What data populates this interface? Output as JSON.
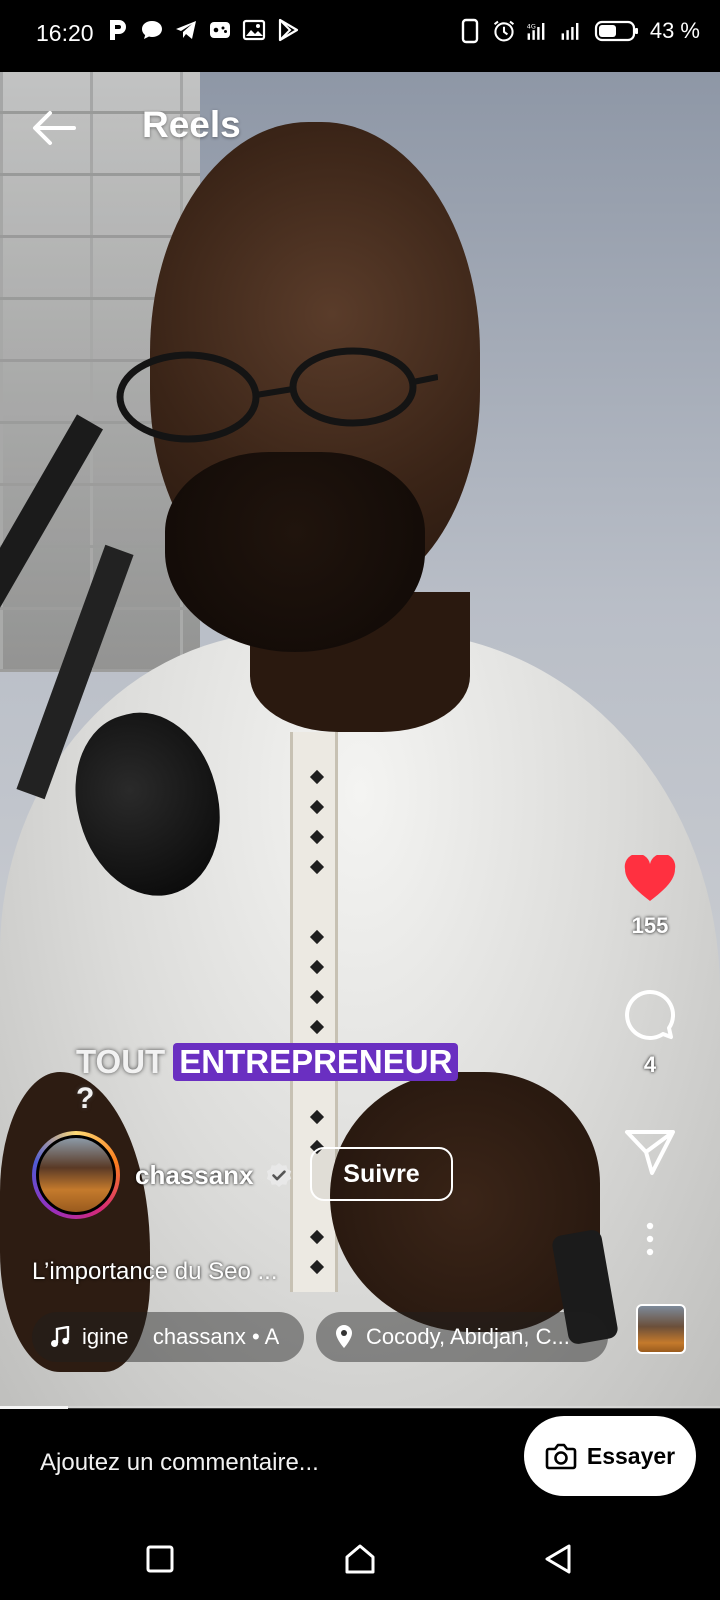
{
  "status_bar": {
    "time": "16:20",
    "battery": "43 %",
    "left_icons": [
      "p-icon",
      "chat-bubble-icon",
      "telegram-icon",
      "game-icon",
      "image-icon",
      "play-store-icon"
    ],
    "right_icons": [
      "phone-outline-icon",
      "alarm-icon",
      "signal-icon",
      "signal-icon",
      "battery-icon"
    ]
  },
  "header": {
    "title": "Reels",
    "back_icon": "arrow-left-icon"
  },
  "overlay_caption": {
    "word1": "TOUT",
    "word2": "ENTREPRENEUR",
    "line2": "?",
    "highlight_color": "#6a2fc1"
  },
  "actions": {
    "like_count": "155",
    "comment_count": "4",
    "like_color": "#ff3040"
  },
  "author": {
    "username": "chassanx",
    "follow_label": "Suivre",
    "verified": true
  },
  "description": "L’importance du Seo ...",
  "audio": {
    "text": "igine    chassanx • A"
  },
  "location": {
    "text": "Cocody, Abidjan, C..."
  },
  "progress": {
    "fraction": 0.095
  },
  "comment_bar": {
    "placeholder": "Ajoutez un commentaire...",
    "try_label": "Essayer"
  },
  "nav": {
    "items": [
      "recents-square-icon",
      "home-icon",
      "back-triangle-icon"
    ]
  }
}
